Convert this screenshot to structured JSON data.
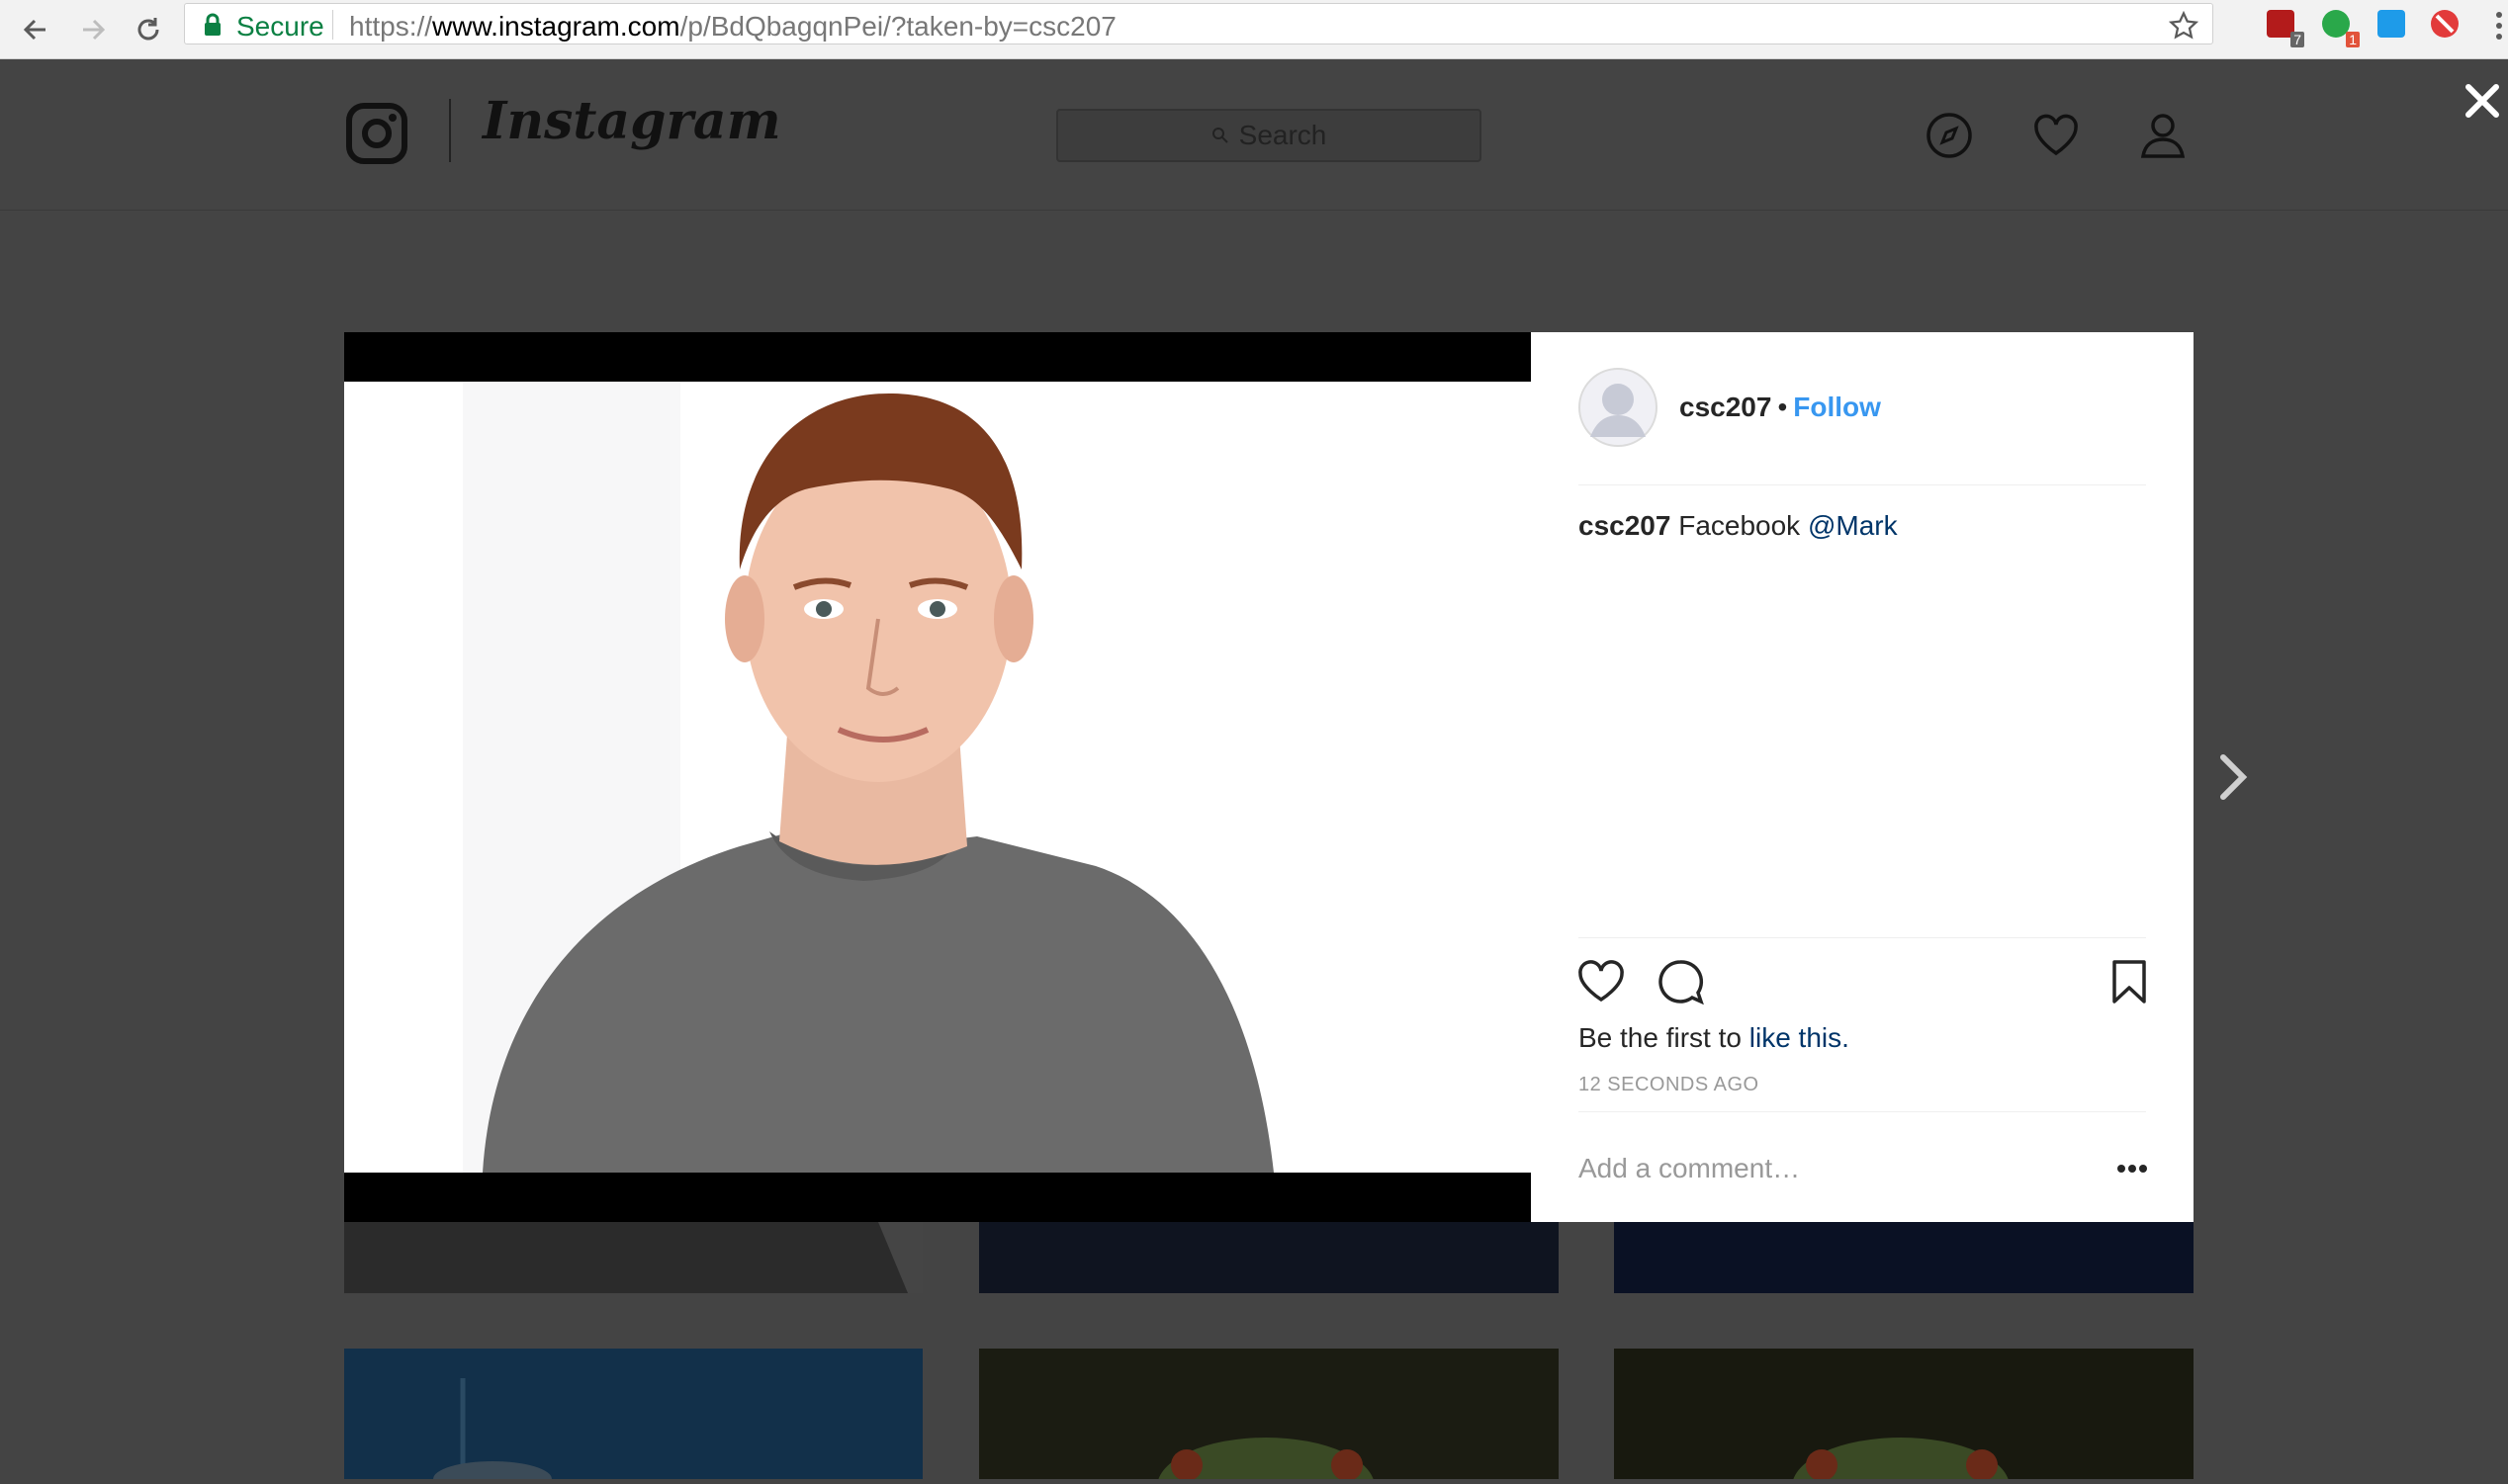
{
  "browser": {
    "secure_label": "Secure",
    "url_scheme": "https://",
    "url_host": "www.instagram.com",
    "url_path": "/p/BdQbagqnPei/?taken-by=csc207",
    "extensions": [
      {
        "name": "ublock-extension",
        "badge": "7",
        "color": "#b31b1b"
      },
      {
        "name": "evernote-extension",
        "badge": "1",
        "color": "#2aa84a"
      },
      {
        "name": "window-extension",
        "badge": "",
        "color": "#1e9be9"
      },
      {
        "name": "blocker-extension",
        "badge": "",
        "color": "#e23b3b"
      }
    ]
  },
  "instagram": {
    "wordmark": "Instagram",
    "search_placeholder": "Search"
  },
  "post": {
    "owner": "csc207",
    "follow_label": "Follow",
    "caption_user": "csc207",
    "caption_text": "Facebook",
    "caption_mention": "@Mark",
    "likes_prefix": "Be the first to",
    "likes_link": "like this.",
    "timestamp": "12 SECONDS AGO",
    "comment_placeholder": "Add a comment…"
  },
  "colors": {
    "accent_blue": "#3897f0",
    "link_dark_blue": "#003569",
    "secure_green": "#0b8043"
  }
}
